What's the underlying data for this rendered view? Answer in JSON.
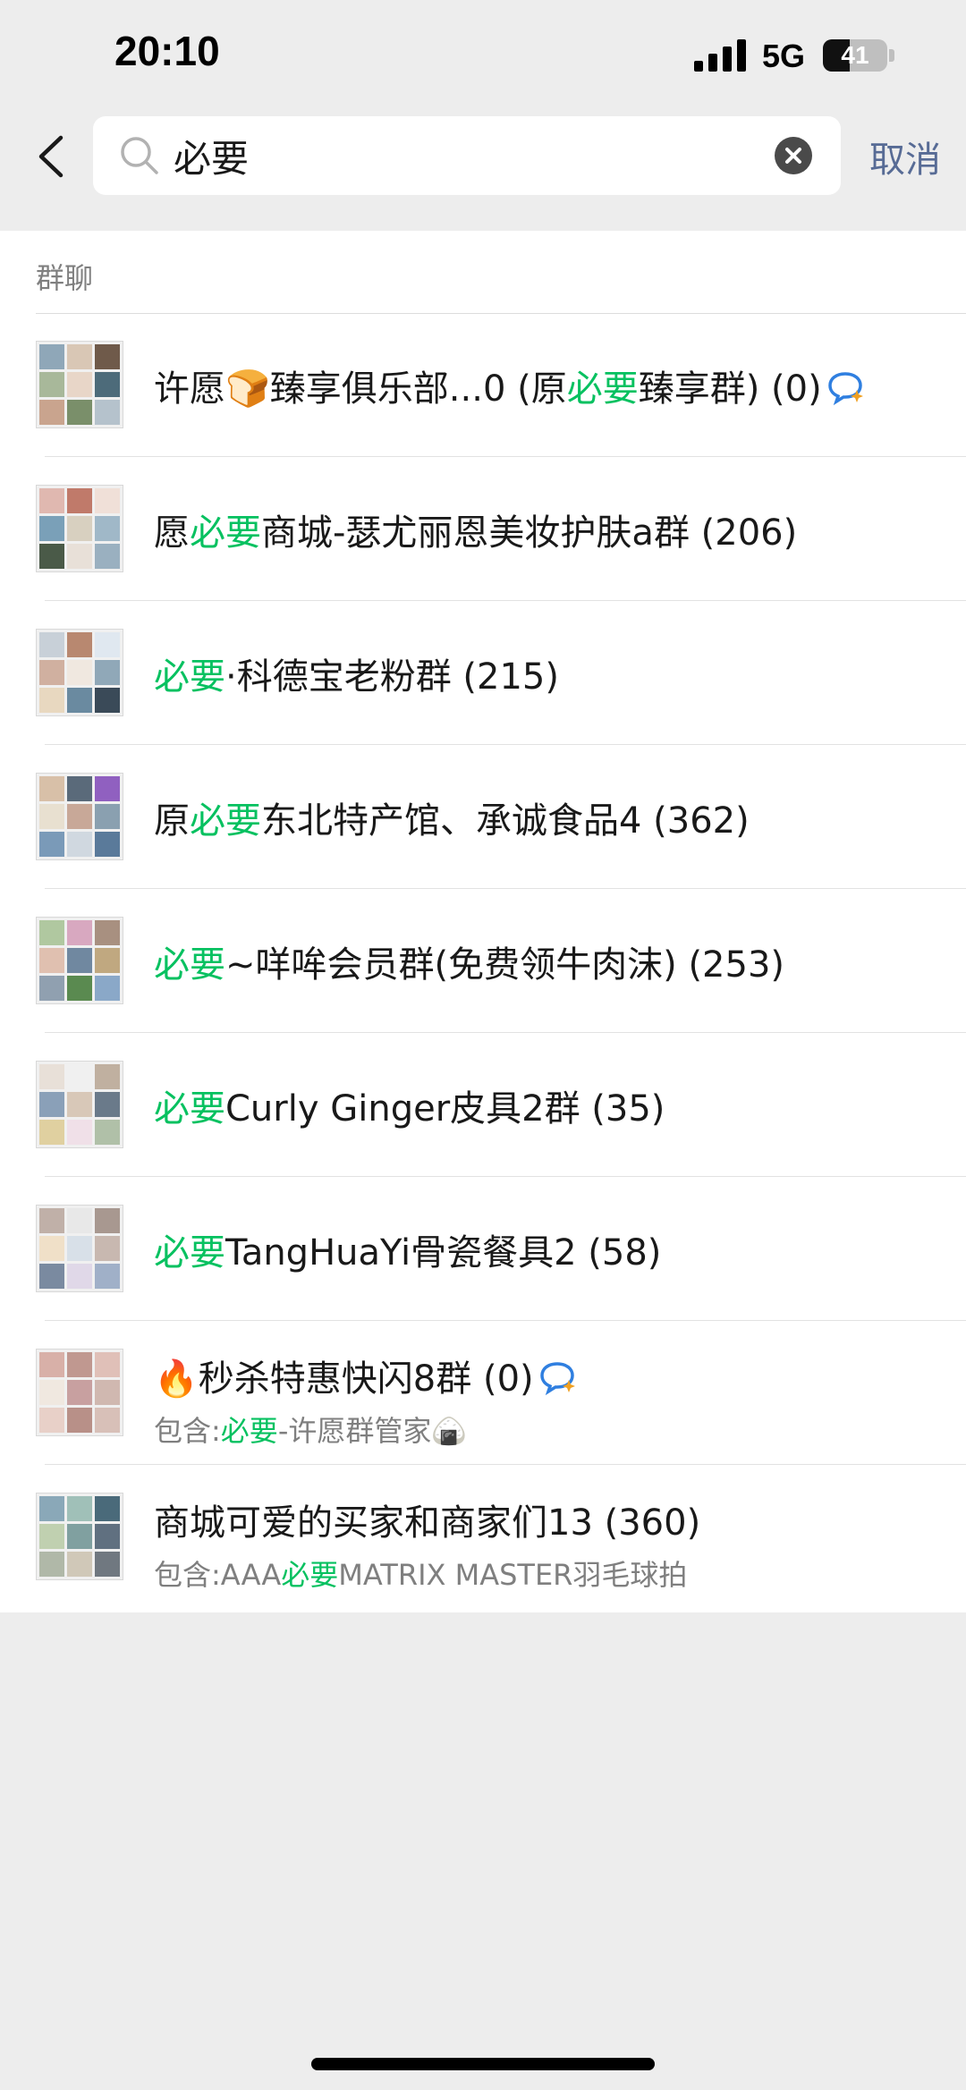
{
  "status": {
    "time": "20:10",
    "network": "5G",
    "battery": "41",
    "battery_level": 0.41
  },
  "search": {
    "query": "必要",
    "cancel_label": "取消"
  },
  "section": {
    "title": "群聊"
  },
  "groups": [
    {
      "pre": "许愿🍞臻享俱乐部...0 (原",
      "hl": "必要",
      "post": "臻享群) (0)",
      "sub_pre": "",
      "sub_hl": "",
      "sub_post": "",
      "ai_icon": true
    },
    {
      "pre": "愿",
      "hl": "必要",
      "post": "商城-瑟尤丽恩美妆护肤a群 (206)",
      "sub_pre": "",
      "sub_hl": "",
      "sub_post": "",
      "ai_icon": false
    },
    {
      "pre": "",
      "hl": "必要",
      "post": "·科德宝老粉群 (215)",
      "sub_pre": "",
      "sub_hl": "",
      "sub_post": "",
      "ai_icon": false
    },
    {
      "pre": "原",
      "hl": "必要",
      "post": "东北特产馆、承诚食品4 (362)",
      "sub_pre": "",
      "sub_hl": "",
      "sub_post": "",
      "ai_icon": false
    },
    {
      "pre": "",
      "hl": "必要",
      "post": "~咩哞会员群(免费领牛肉沫) (253)",
      "sub_pre": "",
      "sub_hl": "",
      "sub_post": "",
      "ai_icon": false
    },
    {
      "pre": "",
      "hl": "必要",
      "post": "Curly Ginger皮具2群 (35)",
      "sub_pre": "",
      "sub_hl": "",
      "sub_post": "",
      "ai_icon": false
    },
    {
      "pre": "",
      "hl": "必要",
      "post": "TangHuaYi骨瓷餐具2 (58)",
      "sub_pre": "",
      "sub_hl": "",
      "sub_post": "",
      "ai_icon": false
    },
    {
      "pre": "🔥秒杀特惠快闪8群 (0)",
      "hl": "",
      "post": "",
      "sub_pre": "包含:",
      "sub_hl": "必要",
      "sub_post": "-许愿群管家🍙",
      "ai_icon": true
    },
    {
      "pre": "商城可爱的买家和商家们13 (360)",
      "hl": "",
      "post": "",
      "sub_pre": "包含:AAA",
      "sub_hl": "必要",
      "sub_post": "MATRIX MASTER羽毛球拍",
      "ai_icon": false
    }
  ],
  "icons": {
    "back": "chevron-left-icon",
    "search": "search-icon",
    "clear": "clear-icon",
    "ai": "ai-chat-icon"
  },
  "colors": {
    "highlight": "#07c160",
    "link": "#576b95",
    "background": "#ededed"
  }
}
